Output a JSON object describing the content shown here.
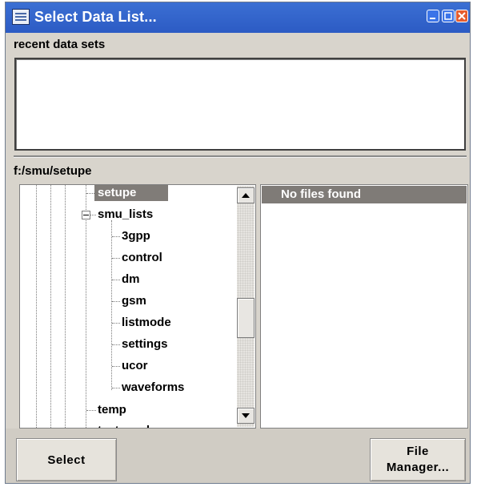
{
  "window": {
    "title": "Select Data List...",
    "title_icon": "list-window-icon",
    "controls": [
      "minimize-icon",
      "maximize-icon",
      "close-icon"
    ]
  },
  "recent": {
    "label": "recent data sets",
    "items": []
  },
  "path": {
    "label": "f:/smu/setupe"
  },
  "tree": {
    "nodes": [
      {
        "label": "setupe",
        "selected": true
      },
      {
        "label": "smu_lists",
        "expanded": true
      },
      {
        "label": "3gpp"
      },
      {
        "label": "control"
      },
      {
        "label": "dm"
      },
      {
        "label": "gsm"
      },
      {
        "label": "listmode"
      },
      {
        "label": "settings"
      },
      {
        "label": "ucor"
      },
      {
        "label": "waveforms"
      },
      {
        "label": "temp"
      },
      {
        "label": "test_anal"
      }
    ]
  },
  "files": {
    "header": "No files found"
  },
  "buttons": {
    "select": "Select",
    "file_manager_line1": "File",
    "file_manager_line2": "Manager..."
  },
  "colors": {
    "titlebar": "#2c5bc4",
    "selection": "#807c78",
    "dialog_bg": "#d8d4cc"
  }
}
